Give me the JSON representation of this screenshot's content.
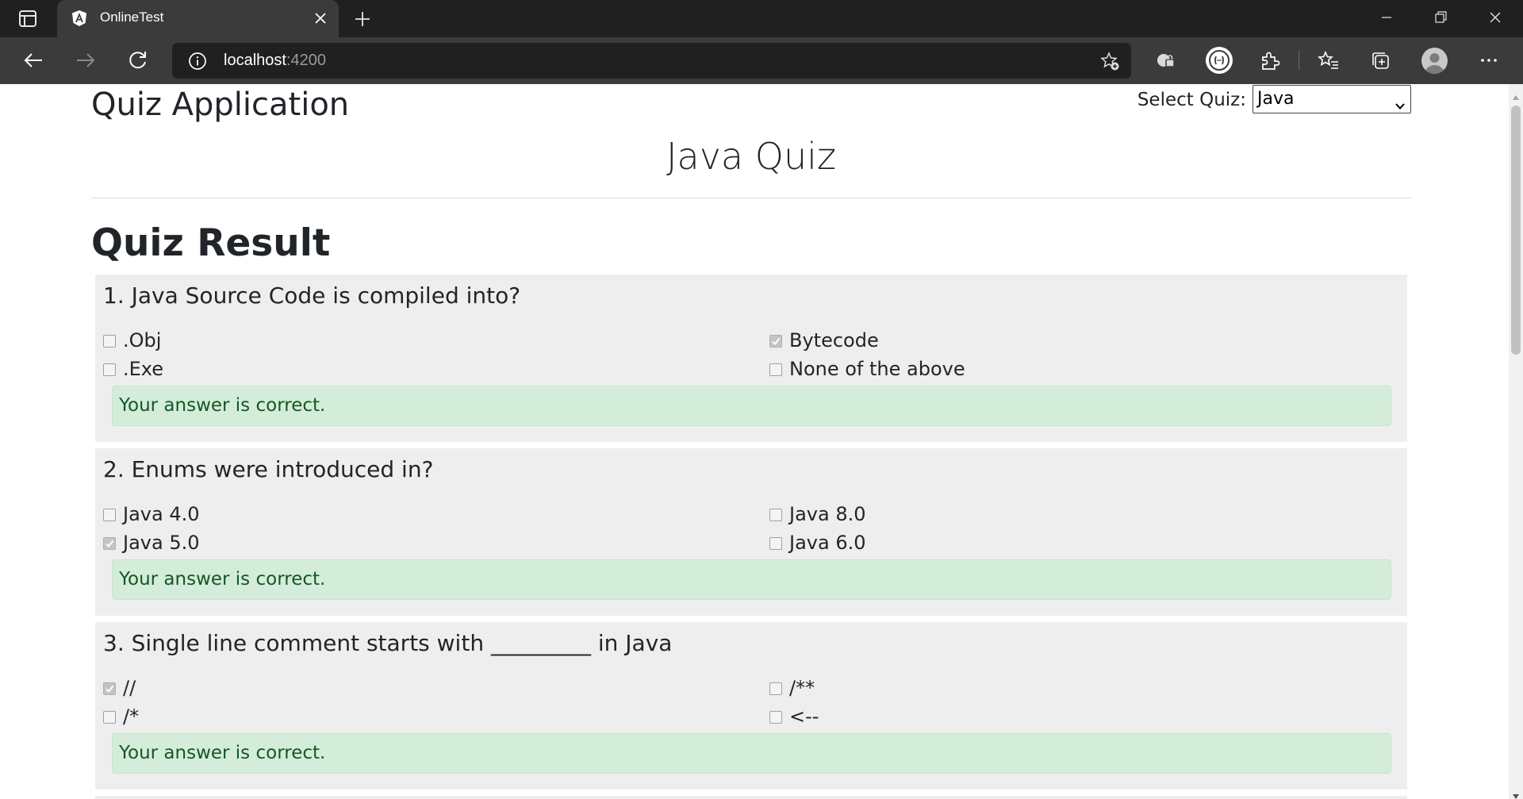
{
  "browser": {
    "tab_title": "OnlineTest",
    "url_host": "localhost",
    "url_port": ":4200"
  },
  "header": {
    "app_title": "Quiz Application",
    "select_label": "Select Quiz:",
    "selected_quiz": "Java"
  },
  "quiz": {
    "title": "Java Quiz",
    "result_heading": "Quiz Result"
  },
  "questions": [
    {
      "text": "1. Java Source Code is compiled into?",
      "options": [
        {
          "label": ".Obj",
          "checked": false
        },
        {
          "label": "Bytecode",
          "checked": true
        },
        {
          "label": ".Exe",
          "checked": false
        },
        {
          "label": "None of the above",
          "checked": false
        }
      ],
      "feedback": "Your answer is correct."
    },
    {
      "text": "2. Enums were introduced in?",
      "options": [
        {
          "label": "Java 4.0",
          "checked": false
        },
        {
          "label": "Java 8.0",
          "checked": false
        },
        {
          "label": "Java 5.0",
          "checked": true
        },
        {
          "label": "Java 6.0",
          "checked": false
        }
      ],
      "feedback": "Your answer is correct."
    },
    {
      "text": "3. Single line comment starts with _________ in Java",
      "options": [
        {
          "label": "//",
          "checked": true
        },
        {
          "label": "/**",
          "checked": false
        },
        {
          "label": "/*",
          "checked": false
        },
        {
          "label": "<--",
          "checked": false
        }
      ],
      "feedback": "Your answer is correct."
    }
  ],
  "colors": {
    "card_background": "#eeeeee",
    "success_background": "#d4edda",
    "success_text": "#155724",
    "chrome_dark": "#202020",
    "chrome_toolbar": "#3b3b3b"
  }
}
